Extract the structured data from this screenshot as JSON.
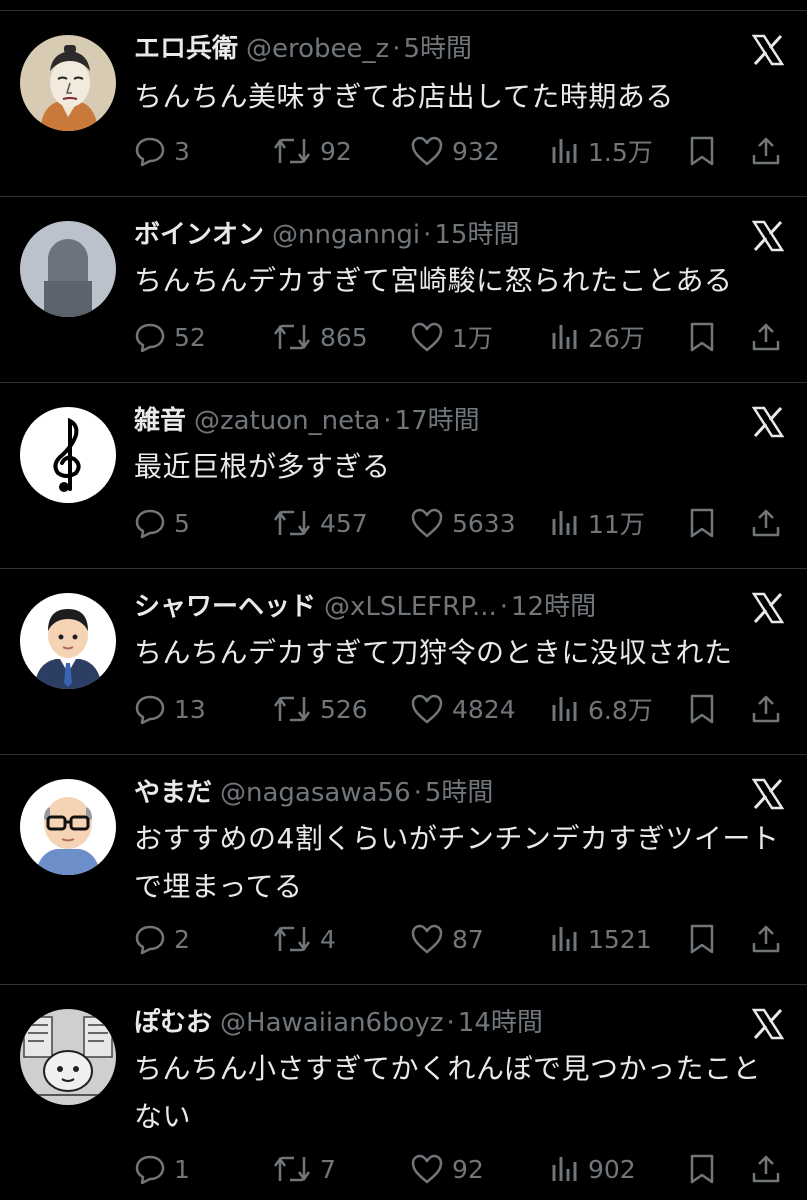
{
  "tweets": [
    {
      "name": "エロ兵衛",
      "handle": "@erobee_z",
      "time": "5時間",
      "text": "ちんちん美味すぎてお店出してた時期ある",
      "replies": "3",
      "retweets": "92",
      "likes": "932",
      "views": "1.5万",
      "avatar": "ukiyoe-portrait"
    },
    {
      "name": "ボインオン",
      "handle": "@nnganngi",
      "time": "15時間",
      "text": "ちんちんデカすぎて宮崎駿に怒られたことある",
      "replies": "52",
      "retweets": "865",
      "likes": "1万",
      "views": "26万",
      "avatar": "gray-silhouette"
    },
    {
      "name": "雑音",
      "handle": "@zatuon_neta",
      "time": "17時間",
      "text": "最近巨根が多すぎる",
      "replies": "5",
      "retweets": "457",
      "likes": "5633",
      "views": "11万",
      "avatar": "treble-clef"
    },
    {
      "name": "シャワーヘッド",
      "handle": "@xLSLEFRP...",
      "time": "12時間",
      "text": "ちんちんデカすぎて刀狩令のときに没収された",
      "replies": "13",
      "retweets": "526",
      "likes": "4824",
      "views": "6.8万",
      "avatar": "businessman-illustration"
    },
    {
      "name": "やまだ",
      "handle": "@nagasawa56",
      "time": "5時間",
      "text": "おすすめの4割くらいがチンチンデカすぎツイートで埋まってる",
      "replies": "2",
      "retweets": "4",
      "likes": "87",
      "views": "1521",
      "avatar": "bald-man-glasses-illustration"
    },
    {
      "name": "ぽむお",
      "handle": "@Hawaiian6boyz",
      "time": "14時間",
      "text": "ちんちん小さすぎてかくれんぼで見つかったことない",
      "replies": "1",
      "retweets": "7",
      "likes": "92",
      "views": "902",
      "avatar": "manga-panel"
    }
  ],
  "icons": {
    "reply": "reply-icon",
    "retweet": "retweet-icon",
    "like": "like-icon",
    "views": "views-icon",
    "bookmark": "bookmark-icon",
    "share": "share-icon",
    "platform": "x-logo-icon"
  },
  "colors": {
    "background": "#000000",
    "text": "#e7e9ea",
    "muted": "#71767b",
    "divider": "#2f3336"
  }
}
